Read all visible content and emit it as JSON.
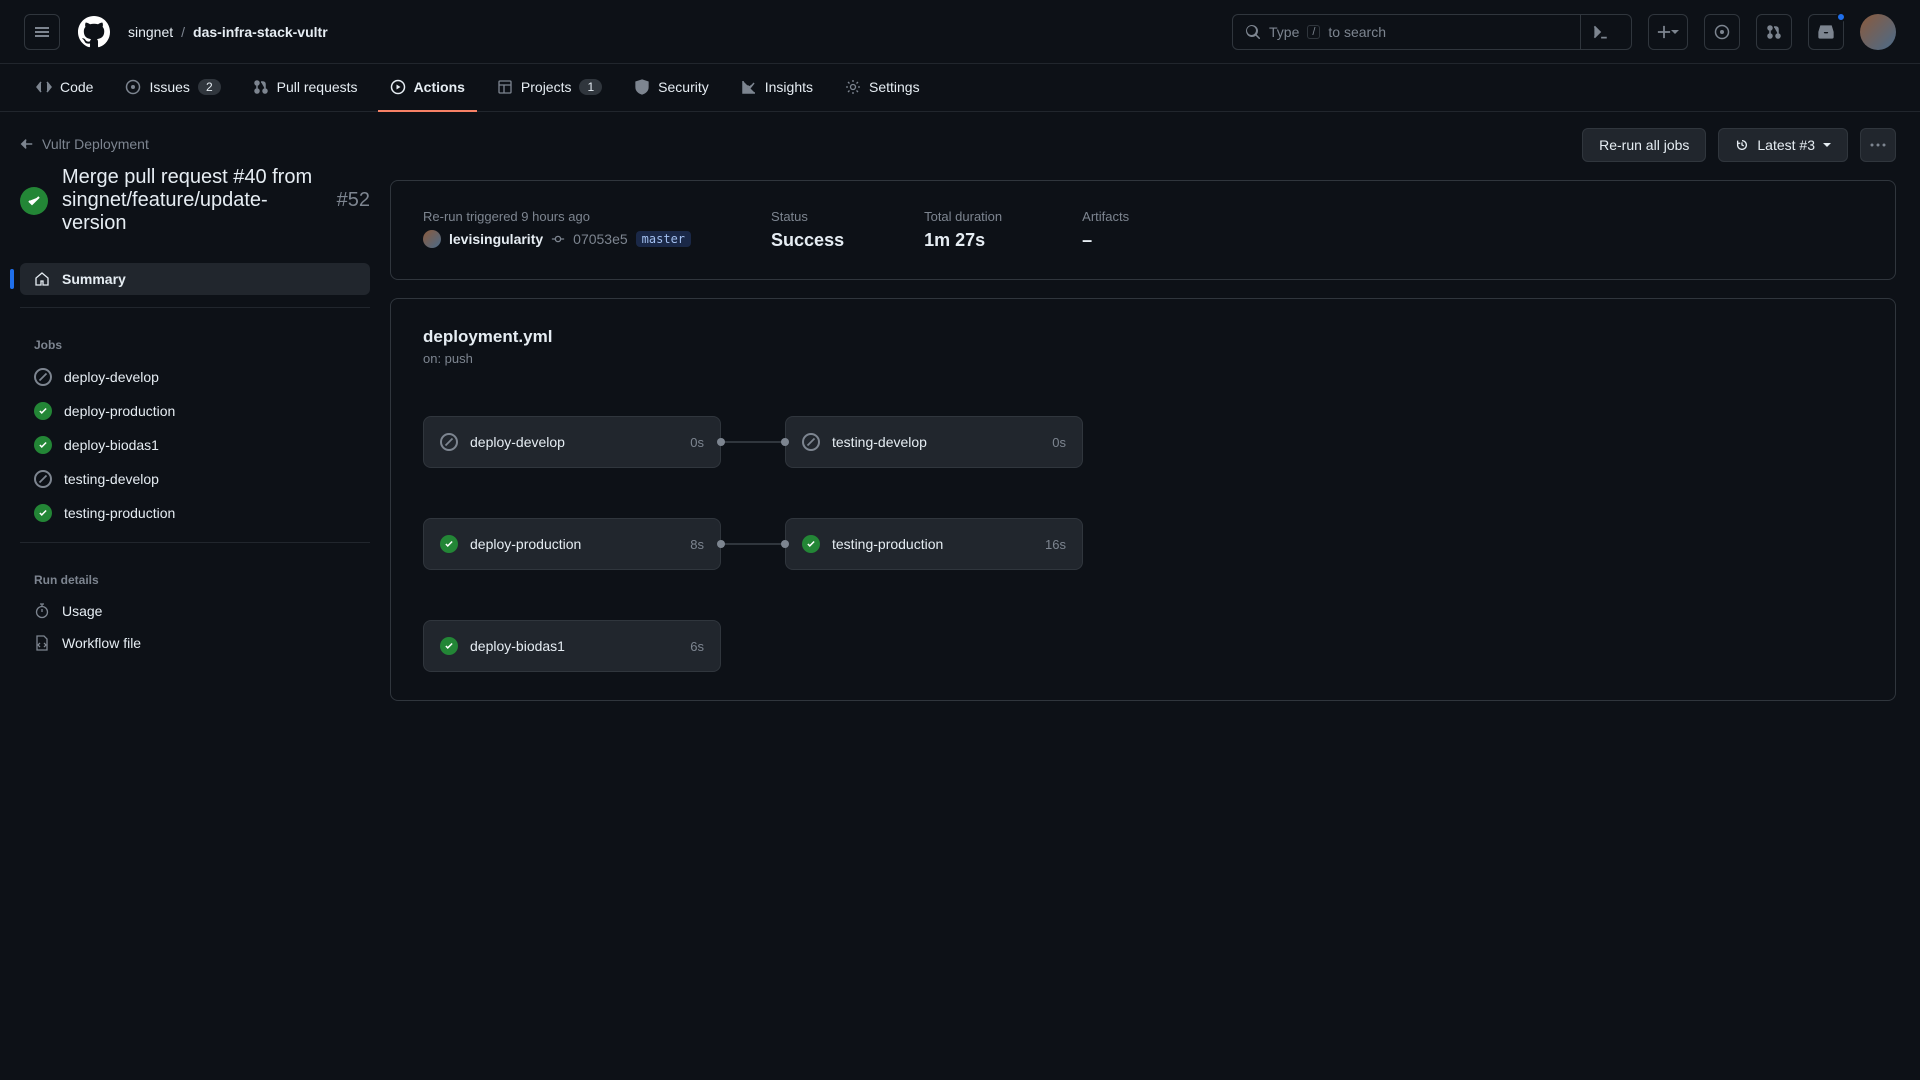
{
  "header": {
    "org": "singnet",
    "repo": "das-infra-stack-vultr",
    "search_pre": "Type",
    "search_key": "/",
    "search_post": "to search"
  },
  "nav": {
    "code": "Code",
    "issues": "Issues",
    "issues_count": "2",
    "pulls": "Pull requests",
    "actions": "Actions",
    "projects": "Projects",
    "projects_count": "1",
    "security": "Security",
    "insights": "Insights",
    "settings": "Settings"
  },
  "back": "Vultr Deployment",
  "title": "Merge pull request #40 from singnet/feature/update-version",
  "run_number": "#52",
  "rerun_btn": "Re-run all jobs",
  "latest_btn": "Latest #3",
  "sidebar": {
    "summary": "Summary",
    "jobs_heading": "Jobs",
    "jobs": [
      {
        "name": "deploy-develop",
        "status": "skipped"
      },
      {
        "name": "deploy-production",
        "status": "success"
      },
      {
        "name": "deploy-biodas1",
        "status": "success"
      },
      {
        "name": "testing-develop",
        "status": "skipped"
      },
      {
        "name": "testing-production",
        "status": "success"
      }
    ],
    "details_heading": "Run details",
    "usage": "Usage",
    "workflow_file": "Workflow file"
  },
  "summary": {
    "trigger_label": "Re-run triggered 9 hours ago",
    "actor": "levisingularity",
    "sha": "07053e5",
    "branch": "master",
    "status_label": "Status",
    "status_val": "Success",
    "duration_label": "Total duration",
    "duration_val": "1m 27s",
    "artifacts_label": "Artifacts",
    "artifacts_val": "–"
  },
  "graph": {
    "file": "deployment.yml",
    "trigger": "on: push",
    "rows": [
      [
        {
          "name": "deploy-develop",
          "status": "skipped",
          "dur": "0s"
        },
        {
          "name": "testing-develop",
          "status": "skipped",
          "dur": "0s"
        }
      ],
      [
        {
          "name": "deploy-production",
          "status": "success",
          "dur": "8s"
        },
        {
          "name": "testing-production",
          "status": "success",
          "dur": "16s"
        }
      ],
      [
        {
          "name": "deploy-biodas1",
          "status": "success",
          "dur": "6s"
        }
      ]
    ]
  }
}
